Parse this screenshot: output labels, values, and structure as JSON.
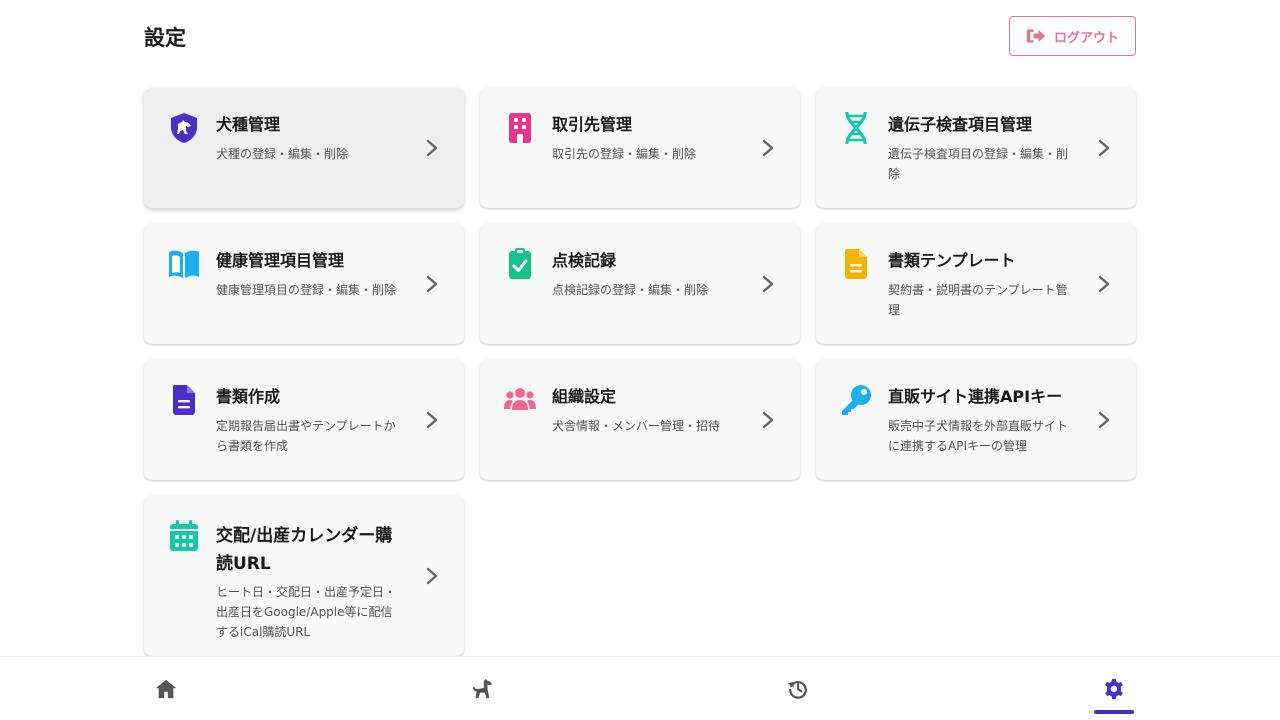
{
  "header": {
    "title": "設定",
    "logout_label": "ログアウト"
  },
  "cards": [
    {
      "title": "犬種管理",
      "desc": "犬種の登録・編集・削除",
      "icon": "dog-shield-icon",
      "color": "#4a2fc8"
    },
    {
      "title": "取引先管理",
      "desc": "取引先の登録・編集・削除",
      "icon": "building-icon",
      "color": "#e8338f"
    },
    {
      "title": "遺伝子検査項目管理",
      "desc": "遺伝子検査項目の登録・編集・削除",
      "icon": "dna-icon",
      "color": "#12c9a8"
    },
    {
      "title": "健康管理項目管理",
      "desc": "健康管理項目の登録・編集・削除",
      "icon": "book-open-icon",
      "color": "#1ab0f0"
    },
    {
      "title": "点検記録",
      "desc": "点検記録の登録・編集・削除",
      "icon": "clipboard-check-icon",
      "color": "#12c48a"
    },
    {
      "title": "書類テンプレート",
      "desc": "契約書・説明書のテンプレート管理",
      "icon": "file-lines-icon",
      "color": "#f5b400"
    },
    {
      "title": "書類作成",
      "desc": "定期報告届出書やテンプレートから書類を作成",
      "icon": "file-text-icon",
      "color": "#4a2fc8"
    },
    {
      "title": "組織設定",
      "desc": "犬舎情報・メンバー管理・招待",
      "icon": "users-icon",
      "color": "#f0688f"
    },
    {
      "title": "直販サイト連携APIキー",
      "desc": "販売中子犬情報を外部直販サイトに連携するAPIキーの管理",
      "icon": "key-icon",
      "color": "#1ab0f0"
    },
    {
      "title": "交配/出産カレンダー購読URL",
      "desc": "ヒート日・交配日・出産予定日・出産日をGoogle/Apple等に配信するiCal購読URL",
      "icon": "calendar-icon",
      "color": "#12c9a8"
    }
  ],
  "nav": {
    "items": [
      {
        "icon": "home-icon"
      },
      {
        "icon": "dog-icon"
      },
      {
        "icon": "history-icon"
      },
      {
        "icon": "gear-icon"
      }
    ],
    "active": "gear-icon"
  },
  "colors": {
    "accent": "#4a2fc8",
    "logout": "#e8738f",
    "nav_icon": "#555555"
  }
}
